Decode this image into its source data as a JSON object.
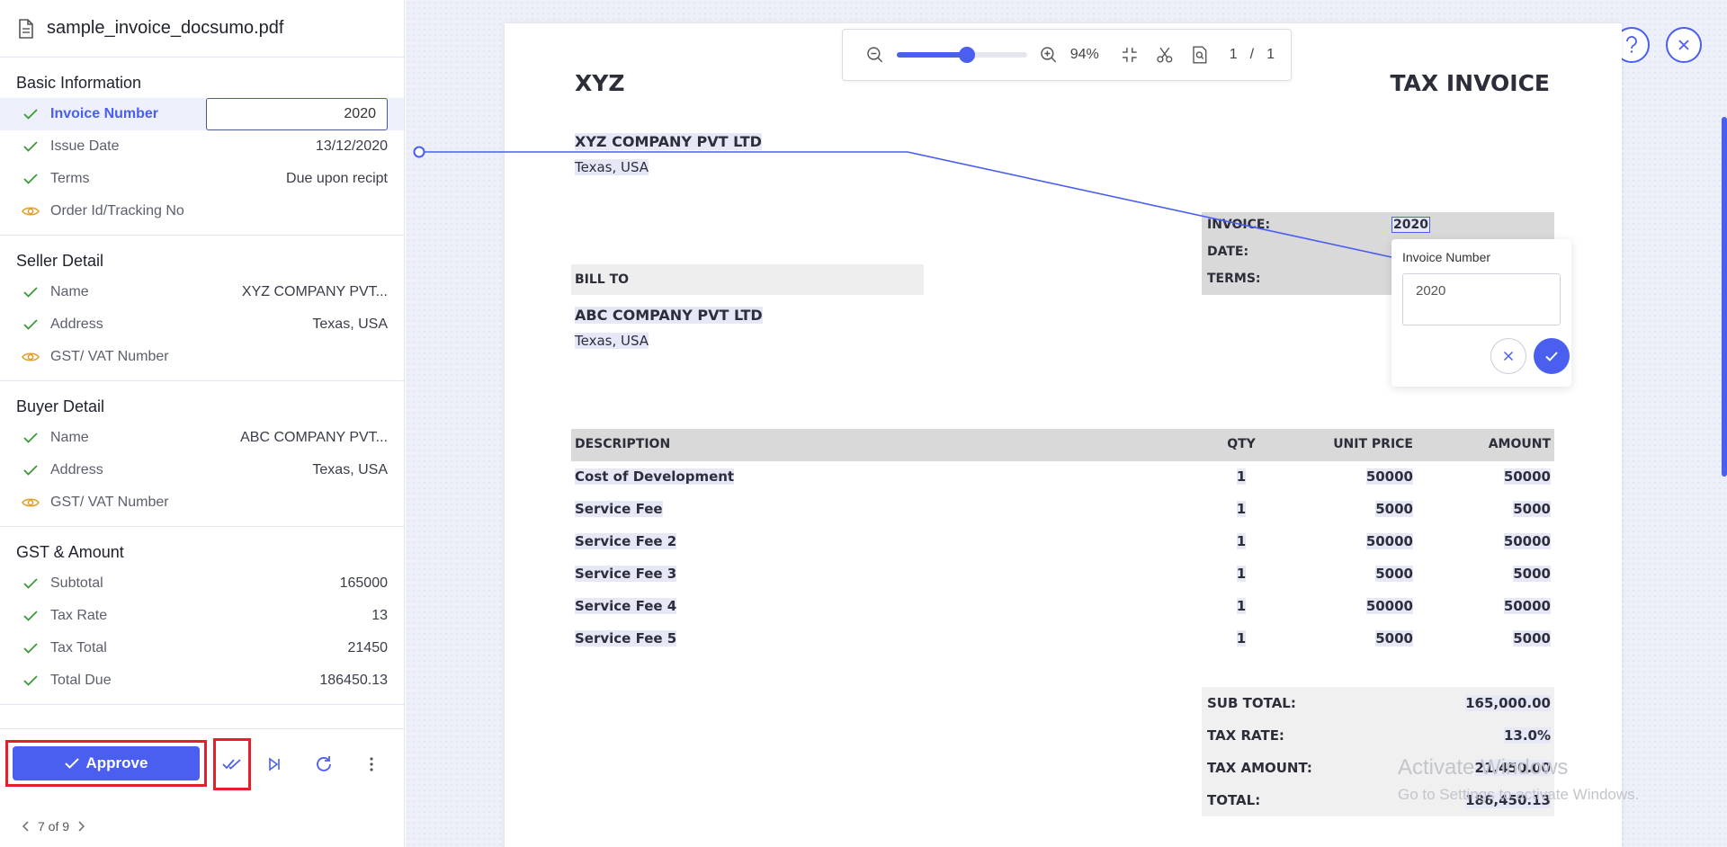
{
  "file": {
    "name": "sample_invoice_docsumo.pdf"
  },
  "sections": [
    {
      "title": "Basic Information",
      "fields": [
        {
          "label": "Invoice Number",
          "value": "2020",
          "status": "check",
          "active": true
        },
        {
          "label": "Issue Date",
          "value": "13/12/2020",
          "status": "check"
        },
        {
          "label": "Terms",
          "value": "Due upon recipt",
          "status": "check"
        },
        {
          "label": "Order Id/Tracking No",
          "value": "",
          "status": "eye"
        }
      ]
    },
    {
      "title": "Seller Detail",
      "fields": [
        {
          "label": "Name",
          "value": "XYZ COMPANY PVT...",
          "status": "check"
        },
        {
          "label": "Address",
          "value": "Texas, USA",
          "status": "check"
        },
        {
          "label": "GST/ VAT Number",
          "value": "",
          "status": "eye"
        }
      ]
    },
    {
      "title": "Buyer Detail",
      "fields": [
        {
          "label": "Name",
          "value": "ABC COMPANY PVT...",
          "status": "check"
        },
        {
          "label": "Address",
          "value": "Texas, USA",
          "status": "check"
        },
        {
          "label": "GST/ VAT Number",
          "value": "",
          "status": "eye"
        }
      ]
    },
    {
      "title": "GST & Amount",
      "fields": [
        {
          "label": "Subtotal",
          "value": "165000",
          "status": "check"
        },
        {
          "label": "Tax Rate",
          "value": "13",
          "status": "check"
        },
        {
          "label": "Tax Total",
          "value": "21450",
          "status": "check"
        },
        {
          "label": "Total Due",
          "value": "186450.13",
          "status": "check"
        }
      ]
    }
  ],
  "footer": {
    "approve_label": "Approve",
    "pager": "7 of 9"
  },
  "toolbar": {
    "zoom": "94%",
    "zoom_level": 0.54,
    "page": "1",
    "page_sep": "/",
    "pages": "1"
  },
  "invoice": {
    "company_short": "XYZ",
    "doc_title": "TAX INVOICE",
    "seller_name": "XYZ COMPANY PVT LTD",
    "seller_address": "Texas, USA",
    "meta_labels": [
      "INVOICE:",
      "DATE:",
      "TERMS:"
    ],
    "invoice_number": "2020",
    "bill_to_label": "BILL TO",
    "buyer_name": "ABC COMPANY PVT LTD",
    "buyer_address": "Texas, USA",
    "columns": [
      "DESCRIPTION",
      "QTY",
      "UNIT PRICE",
      "AMOUNT"
    ],
    "rows": [
      [
        "Cost of Development",
        "1",
        "50000",
        "50000"
      ],
      [
        "Service Fee",
        "1",
        "5000",
        "5000"
      ],
      [
        "Service Fee 2",
        "1",
        "50000",
        "50000"
      ],
      [
        "Service Fee 3",
        "1",
        "5000",
        "5000"
      ],
      [
        "Service Fee 4",
        "1",
        "50000",
        "50000"
      ],
      [
        "Service Fee 5",
        "1",
        "5000",
        "5000"
      ]
    ],
    "totals": [
      [
        "SUB TOTAL:",
        "165,000.00"
      ],
      [
        "TAX RATE:",
        "13.0%"
      ],
      [
        "TAX AMOUNT:",
        "21,450.00"
      ],
      [
        "TOTAL:",
        "186,450.13"
      ]
    ]
  },
  "popup": {
    "title": "Invoice Number",
    "value": "2020"
  },
  "watermark": {
    "line1": "Activate Windows",
    "line2": "Go to Settings to activate Windows."
  },
  "colors": {
    "accent": "#4a5ef0",
    "check": "#3a9a3a",
    "eye": "#e0a02a",
    "highlight_box": "#e5202a"
  }
}
